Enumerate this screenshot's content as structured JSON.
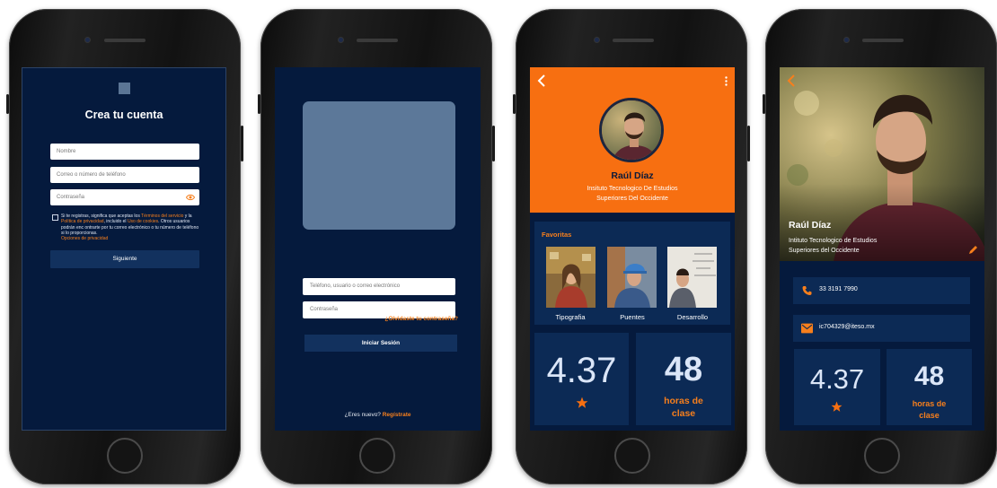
{
  "colors": {
    "navy": "#051a3d",
    "panel": "#0c2a55",
    "accent_orange": "#f76f11",
    "placeholder_slate": "#5c7899"
  },
  "register": {
    "title": "Crea tu cuenta",
    "name_placeholder": "Nombre",
    "contact_placeholder": "Correo o número de teléfono",
    "password_placeholder": "Contraseña",
    "terms": {
      "part1": "Si te registras, significa que aceptas los ",
      "terms_link": "Términos del servicio",
      "part2": " y la ",
      "privacy_link": "Política de privacidad",
      "part3": ", incluido el ",
      "cookies_link": "Uso de cookies",
      "part4": ". Otros usuarios podrán enc ontrarte por tu correo electrónico o tu número de teléfono si lo proporcionas.",
      "options_link": "Opciones de privacidad"
    },
    "submit_label": "Siguiente"
  },
  "login": {
    "user_placeholder": "Teléfono, usuario o correo electrónico",
    "password_placeholder": "Contraseña",
    "forgot_label": "¿Olvidaste tu contraseña?",
    "submit_label": "Iniciar Sesión",
    "new_user_text": "¿Eres nuevo? ",
    "register_link": "Regístrate"
  },
  "profile": {
    "name": "Raúl Díaz",
    "institute_line1": "Insituto Tecnologico De Estudios",
    "institute_line2": "Superiores Del Occidente",
    "favorites_title": "Favoritas",
    "favorites": [
      {
        "label": "Tipografia"
      },
      {
        "label": "Puentes"
      },
      {
        "label": "Desarrollo"
      }
    ],
    "rating": "4.37",
    "hours": "48",
    "hours_label_line1": "horas de",
    "hours_label_line2": "clase"
  },
  "detail": {
    "name": "Raúl Díaz",
    "institute_line1": "Intituto Tecnologico de Estudios",
    "institute_line2": "Superiores del Occidente",
    "phone": "33 3191 7990",
    "email": "ic704329@iteso.mx",
    "rating": "4.37",
    "hours": "48",
    "hours_label_line1": "horas de",
    "hours_label_line2": "clase"
  }
}
